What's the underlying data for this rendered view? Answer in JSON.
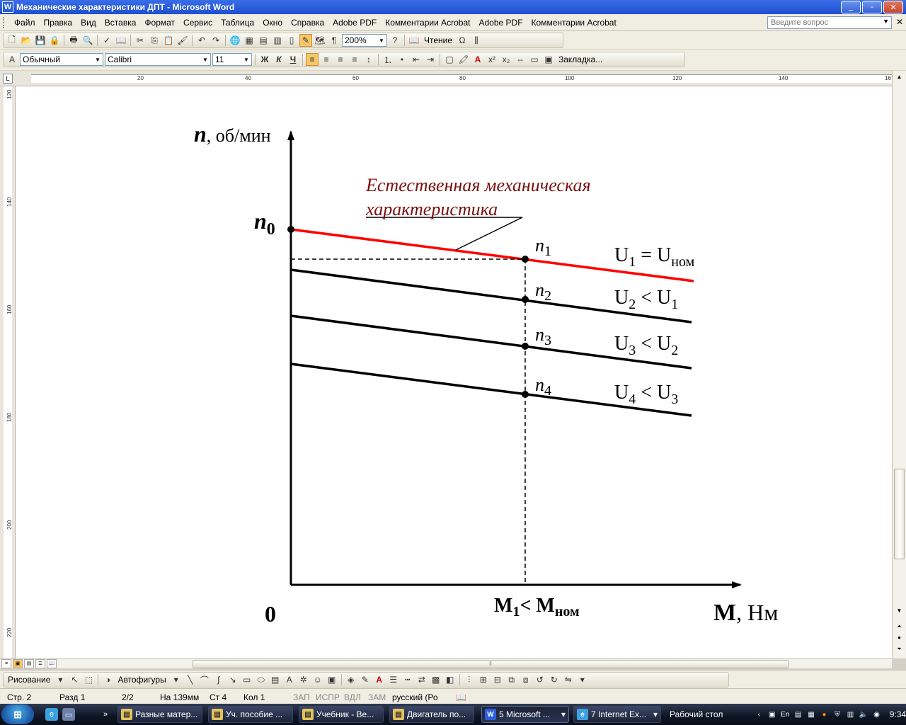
{
  "window": {
    "title": "Механические характеристики ДПТ - Microsoft Word",
    "app_glyph": "W",
    "min": "_",
    "restore": "▫",
    "close": "✕"
  },
  "menu": {
    "items": [
      "Файл",
      "Правка",
      "Вид",
      "Вставка",
      "Формат",
      "Сервис",
      "Таблица",
      "Окно",
      "Справка",
      "Adobe PDF",
      "Комментарии Acrobat",
      "Adobe PDF",
      "Комментарии Acrobat"
    ],
    "ask_placeholder": "Введите вопрос"
  },
  "standard_toolbar": {
    "zoom": "200%",
    "reading": "Чтение",
    "omega": "Ω"
  },
  "format_toolbar": {
    "style": "Обычный",
    "font": "Calibri",
    "size": "11",
    "bold": "Ж",
    "italic": "К",
    "underline": "Ч",
    "bookmark": "Закладка...",
    "superscript": "x²",
    "subscript": "x₂"
  },
  "ruler": {
    "corner": "L",
    "h_numbers": [
      "20",
      "40",
      "60",
      "80",
      "100",
      "120",
      "140",
      "16"
    ],
    "v_numbers": [
      "120",
      "140",
      "160",
      "180",
      "200",
      "220"
    ]
  },
  "chart": {
    "y_axis_var": "n",
    "y_axis_unit": ", об/мин",
    "x_axis_var": "M",
    "x_axis_unit": ", Нм",
    "origin": "0",
    "n0_main": "n",
    "n0_sub": "0",
    "natural_label_line1": "Естественная механическая",
    "natural_label_line2": "характеристика",
    "m1_main": "M",
    "m1_sub": "1",
    "m1_rest": "< M",
    "m1_sub2": "ном",
    "lines": [
      {
        "point": "n",
        "point_sub": "1",
        "u": "U",
        "u_sub": "1",
        "relation": " = U",
        "rel_sub": "ном",
        "color": "#ff0000"
      },
      {
        "point": "n",
        "point_sub": "2",
        "u": "U",
        "u_sub": "2",
        "relation": " < U",
        "rel_sub": "1",
        "color": "#000000"
      },
      {
        "point": "n",
        "point_sub": "3",
        "u": "U",
        "u_sub": "3",
        "relation": " < U",
        "rel_sub": "2",
        "color": "#000000"
      },
      {
        "point": "n",
        "point_sub": "4",
        "u": "U",
        "u_sub": "4",
        "relation": " < U",
        "rel_sub": "3",
        "color": "#000000"
      }
    ],
    "label_color": "#7a0f0f"
  },
  "drawing_toolbar": {
    "drawing": "Рисование",
    "autoshapes": "Автофигуры"
  },
  "status": {
    "page": "Стр. 2",
    "section": "Разд 1",
    "pages": "2/2",
    "at": "На 139мм",
    "line": "Ст 4",
    "col": "Кол 1",
    "rec": "ЗАП",
    "trk": "ИСПР",
    "ext": "ВДЛ",
    "ovr": "ЗАМ",
    "lang": "русский (Ро"
  },
  "taskbar": {
    "start_glyph": "⊞",
    "buttons": [
      {
        "label": "Разные матер...",
        "glyph": "▤",
        "color": "#e3c35a"
      },
      {
        "label": "Уч. пособие ...",
        "glyph": "▤",
        "color": "#e3c35a"
      },
      {
        "label": "Учебник - Ве...",
        "glyph": "▤",
        "color": "#e3c35a"
      },
      {
        "label": "Двигатель по...",
        "glyph": "▤",
        "color": "#e3c35a"
      },
      {
        "label": "5 Microsoft ...",
        "glyph": "W",
        "color": "#2b5fd9"
      },
      {
        "label": "7 Internet Ex...",
        "glyph": "e",
        "color": "#3aa0e0"
      }
    ],
    "desktop": "Рабочий стол",
    "lang": "En",
    "time": "9:34"
  }
}
